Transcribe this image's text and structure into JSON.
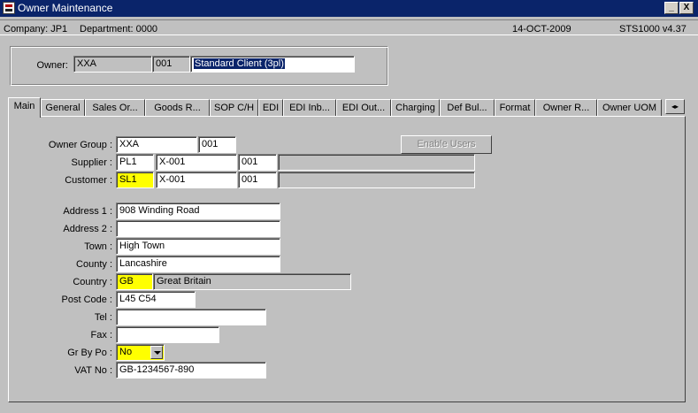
{
  "window": {
    "title": "Owner Maintenance",
    "minimize_label": "_",
    "close_label": "X"
  },
  "info": {
    "company": "Company:  JP1",
    "department": "Department:  0000",
    "date": "14-OCT-2009",
    "version": "STS1000  v4.37"
  },
  "owner": {
    "label": "Owner:",
    "code": "XXA",
    "number": "001",
    "name": "Standard Client (3pl)"
  },
  "tabs": [
    {
      "label": "Main"
    },
    {
      "label": "General"
    },
    {
      "label": "Sales Or..."
    },
    {
      "label": "Goods R..."
    },
    {
      "label": "SOP C/H"
    },
    {
      "label": "EDI"
    },
    {
      "label": "EDI Inb..."
    },
    {
      "label": "EDI Out..."
    },
    {
      "label": "Charging"
    },
    {
      "label": "Def Bul..."
    },
    {
      "label": "Format"
    },
    {
      "label": "Owner R..."
    },
    {
      "label": "Owner UOM"
    }
  ],
  "tab_scroll": "◂▸",
  "form": {
    "owner_group": {
      "label": "Owner Group :",
      "code": "XXA",
      "number": "001"
    },
    "enable_users_label": "Enable Users",
    "supplier": {
      "label": "Supplier :",
      "code": "PL1",
      "ref": "X-001",
      "number": "001",
      "desc": ""
    },
    "customer": {
      "label": "Customer :",
      "code": "SL1",
      "ref": "X-001",
      "number": "001",
      "desc": ""
    },
    "address1": {
      "label": "Address 1 :",
      "value": "908 Winding Road"
    },
    "address2": {
      "label": "Address 2 :",
      "value": ""
    },
    "town": {
      "label": "Town :",
      "value": "High Town"
    },
    "county": {
      "label": "County :",
      "value": "Lancashire"
    },
    "country": {
      "label": "Country :",
      "code": "GB",
      "name": "Great Britain"
    },
    "post_code": {
      "label": "Post Code :",
      "value": "L45 C54"
    },
    "tel": {
      "label": "Tel :",
      "value": ""
    },
    "fax": {
      "label": "Fax :",
      "value": ""
    },
    "gr_by_po": {
      "label": "Gr By Po :",
      "value": "No"
    },
    "vat_no": {
      "label": "VAT No :",
      "value": "GB-1234567-890"
    }
  },
  "colors": {
    "title_bar": "#0a246a",
    "required_field": "#ffff00",
    "window_face": "#c0c0c0"
  }
}
